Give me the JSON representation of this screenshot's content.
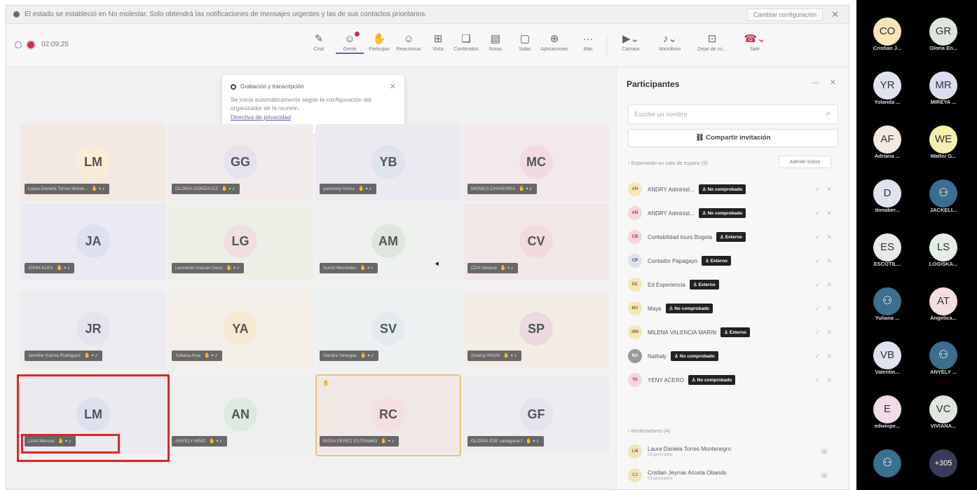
{
  "notification": {
    "text": "El estado se estableció en No molestar. Solo obtendrá las notificaciones de mensajes urgentes y las de sus contactos prioritarios.",
    "change_label": "Cambiar configuración",
    "close": "✕"
  },
  "recording": {
    "time": "02:09:25"
  },
  "toolbar": {
    "chat": "Chat",
    "people": "Gente",
    "raise": "Participar",
    "react": "Reaccionar",
    "view": "Vista",
    "rooms": "Contenidos",
    "notes": "Notas",
    "rooms2": "Salas",
    "apps": "Aplicaciones",
    "more": "Más",
    "camera": "Cámara",
    "mic": "Micrófono",
    "share": "Dejar de co...",
    "leave": "Salir"
  },
  "popup": {
    "title": "Grabación y transcripción",
    "body": "Se inicia automáticamente según la configuración del organizador de la reunión.",
    "link": "Directiva de privacidad"
  },
  "tiles": [
    {
      "initials": "LM",
      "name": "Laura Daniela Torres Monte...",
      "bg": "#fbecd6",
      "tile": "#f4e9e2"
    },
    {
      "initials": "GG",
      "name": "GLORIA GONZALEZ",
      "bg": "#e6e3ef",
      "tile": "#f1ebec"
    },
    {
      "initials": "YB",
      "name": "yasmeny trivino",
      "bg": "#dee3ef",
      "tile": "#eceaf0"
    },
    {
      "initials": "MC",
      "name": "MONICA CHAVERRA",
      "bg": "#f1dbe0",
      "tile": "#f3e9ec"
    },
    {
      "initials": "JA",
      "name": "JOHN ALEX",
      "bg": "#dbe1f1",
      "tile": "#ebeaf2"
    },
    {
      "initials": "LG",
      "name": "Leonardo Asesas Gecn",
      "bg": "#f1dee1",
      "tile": "#edf0e6"
    },
    {
      "initials": "AM",
      "name": "Aurori Mercedes",
      "bg": "#dde7dd",
      "tile": "#eef1ee"
    },
    {
      "initials": "CV",
      "name": "CDA Vanesa",
      "bg": "#f1dbdb",
      "tile": "#f3e8e8"
    },
    {
      "initials": "JR",
      "name": "Jennifer Karina Rodriguez",
      "bg": "#e4e4ef",
      "tile": "#ecebf0"
    },
    {
      "initials": "YA",
      "name": "Yuliana Arce",
      "bg": "#f7e8d2",
      "tile": "#f4eee8"
    },
    {
      "initials": "SV",
      "name": "Sandra Venegas",
      "bg": "#e2ecef",
      "tile": "#eef1f2"
    },
    {
      "initials": "SP",
      "name": "Solanyi PAIVA",
      "bg": "#ecd9df",
      "tile": "#f3ede6"
    },
    {
      "initials": "LM",
      "name": "LIAN Mercos",
      "bg": "#dde1ef",
      "tile": "#eaeaf0"
    },
    {
      "initials": "AN",
      "name": "ANYELY NIÑO",
      "bg": "#dcebdd",
      "tile": "#edf0ed"
    },
    {
      "initials": "RC",
      "name": "ROSA PEREZ ESTRAMIO",
      "bg": "#f4dede",
      "tile": "#f2e7e7"
    },
    {
      "initials": "GF",
      "name": "GLORIA IDIE cartagena f",
      "bg": "#e6e3ef",
      "tile": "#eeecf1"
    }
  ],
  "panel": {
    "title": "Participantes",
    "search_placeholder": "Escribe un nombre",
    "share_label": "Compartir invitación",
    "waiting_label": "Esperando en sala de espera (9)",
    "admit_all": "Admitir todos",
    "waiting": [
      {
        "abbr": "AN",
        "name": "ANDRY Administ...",
        "tag": "No comprobado",
        "bg": "#f6e6b8",
        "fg": "#8a6d1e"
      },
      {
        "abbr": "AN",
        "name": "ANDRY Administ...",
        "tag": "No comprobado",
        "bg": "#f4d6dc",
        "fg": "#a33"
      },
      {
        "abbr": "CB",
        "name": "Contabilidad tours Bogota",
        "tag": "Externo",
        "bg": "#f4d6dc",
        "fg": "#a33"
      },
      {
        "abbr": "CP",
        "name": "Contador Papagayo",
        "tag": "Externo",
        "bg": "#dee3ef",
        "fg": "#446"
      },
      {
        "abbr": "EE",
        "name": "Ed Experiencia",
        "tag": "Externo",
        "bg": "#f6e6b8",
        "fg": "#8a6d1e"
      },
      {
        "abbr": "MA",
        "name": "Maye",
        "tag": "No comprobado",
        "bg": "#f6e6b8",
        "fg": "#8a6d1e"
      },
      {
        "abbr": "MM",
        "name": "MILENA VALENCIA MARIN",
        "tag": "Externo",
        "bg": "#f6e6b8",
        "fg": "#8a6d1e"
      },
      {
        "abbr": "NA",
        "name": "Nathaly",
        "tag": "No comprobado",
        "bg": "#9a9a9a",
        "fg": "#fff"
      },
      {
        "abbr": "YA",
        "name": "YENY ACERO",
        "tag": "No comprobado",
        "bg": "#f4d6dc",
        "fg": "#a33"
      }
    ],
    "moderators_label": "Moderadores (4)",
    "moderators": [
      {
        "abbr": "LM",
        "name": "Laura Daniela Torres Montenegro",
        "role": "Organizador"
      },
      {
        "abbr": "CJ",
        "name": "Cristian Jeymar Acosta Obando",
        "role": "Organizador"
      }
    ]
  },
  "gallery": [
    {
      "initials": "CO",
      "name": "Cristian J...",
      "bg": "#f6e6b8"
    },
    {
      "initials": "GR",
      "name": "Gloria En...",
      "bg": "#dde7dd"
    },
    {
      "initials": "YR",
      "name": "Yolanda ...",
      "bg": "#dee3ef"
    },
    {
      "initials": "MR",
      "name": "MIREYA ...",
      "bg": "#dcdcf1"
    },
    {
      "initials": "AF",
      "name": "Adriana ...",
      "bg": "#f4e9e2"
    },
    {
      "initials": "WE",
      "name": "Walter G...",
      "bg": "#f6efb0"
    },
    {
      "initials": "D",
      "name": "donaber...",
      "bg": "#dee3ef"
    },
    {
      "initials": "",
      "name": "JACKELI...",
      "bg": "#3b6e8f",
      "person": true
    },
    {
      "initials": "ES",
      "name": "ESCOTIL...",
      "bg": "#e8e8e8"
    },
    {
      "initials": "LS",
      "name": "LOGISKA...",
      "bg": "#e2efe2"
    },
    {
      "initials": "",
      "name": "Yuliana ...",
      "bg": "#3b6e8f",
      "person": true
    },
    {
      "initials": "AT",
      "name": "Angelica...",
      "bg": "#f4dede"
    },
    {
      "initials": "VB",
      "name": "Valentin...",
      "bg": "#dee3ef"
    },
    {
      "initials": "",
      "name": "ANYELY ...",
      "bg": "#3b6e8f",
      "person": true
    },
    {
      "initials": "E",
      "name": "edwinpe...",
      "bg": "#f1dbe8"
    },
    {
      "initials": "VC",
      "name": "VIVIANA...",
      "bg": "#dde7dd"
    },
    {
      "initials": "",
      "name": "",
      "bg": "#3b6e8f",
      "person": true
    },
    {
      "initials": "+305",
      "name": "",
      "bg": "#3a3a5a"
    }
  ]
}
